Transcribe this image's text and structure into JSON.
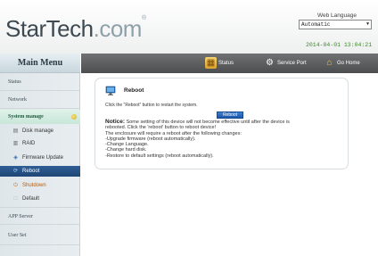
{
  "header": {
    "logo_part1": "StarTech",
    "logo_part2": ".com",
    "logo_tm": "®",
    "web_language_label": "Web Language",
    "language_value": "Automatic",
    "datetime": "2014-04-01 13:04:21"
  },
  "sidebar": {
    "title": "Main Menu",
    "items": {
      "status": "Status",
      "network": "Network",
      "system_manage": "System manage",
      "app_server": "APP Server",
      "user_set": "User Set"
    },
    "sub_items": {
      "disk_manage": "Disk manage",
      "raid": "RAID",
      "firmware_update": "Firmware Update",
      "reboot": "Reboot",
      "shutdown": "Shutdown",
      "default": "Default"
    }
  },
  "topbar": {
    "status": "Status",
    "service_port": "Service Port",
    "go_home": "Go Home"
  },
  "panel": {
    "title": "Reboot",
    "description": "Click the \"Reboot\" button to restart the system.",
    "button": "Reboot",
    "notice_label": "Notice:",
    "notice_text": "Some setting of this device will not become effective until after the device is",
    "notice_lines": [
      "rebooted. Click the 'reboot' button to reboot device!",
      "The enclosure will require a reboot after the following changes:",
      "-Upgrade firmware (reboot automatically).",
      "-Change Language.",
      "-Change hard disk.",
      "-Restore to default settings (reboot automatically)."
    ]
  },
  "colors": {
    "topbar": "#5a5c5e",
    "active_menu": "#c8e6d8",
    "active_sub": "#1f4676",
    "datetime": "#3a8a2a"
  }
}
